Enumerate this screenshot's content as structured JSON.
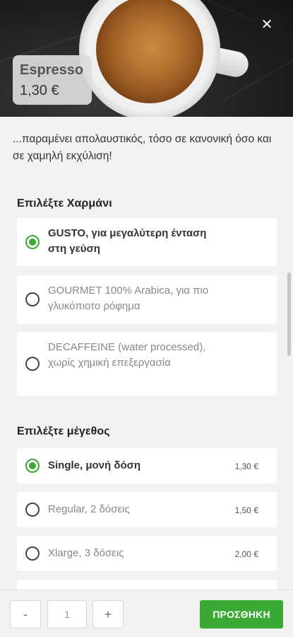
{
  "product": {
    "name": "Espresso",
    "price": "1,30 €",
    "description": "...παραμένει απολαυστικός, τόσο σε κανονική όσο και σε χαμηλή εκχύλιση!",
    "close_icon": "close-icon"
  },
  "blend_section": {
    "title": "Επιλέξτε Χαρμάνι",
    "options": [
      {
        "label": "GUSTO, για μεγαλύτερη ένταση στη γεύση",
        "selected": true
      },
      {
        "label": "GOURMET 100% Arabica, για πιο γλυκόπιοτο ρόφημα",
        "selected": false
      },
      {
        "label": "DECAFFEINE (water processed), χωρίς χημική επεξεργασία",
        "selected": false
      }
    ]
  },
  "size_section": {
    "title": "Επιλέξτε μέγεθος",
    "options": [
      {
        "label": "Single, μονή δόση",
        "price": "1,30 €",
        "selected": true
      },
      {
        "label": "Regular, 2 δόσεις",
        "price": "1,50 €",
        "selected": false
      },
      {
        "label": "Xlarge, 3 δόσεις",
        "price": "2,00 €",
        "selected": false
      }
    ]
  },
  "footer": {
    "minus_label": "-",
    "quantity": "1",
    "plus_label": "+",
    "add_label": "ΠΡΟΣΘΗΚΗ"
  },
  "colors": {
    "accent": "#3aaa35",
    "background": "#f2f2f2"
  }
}
